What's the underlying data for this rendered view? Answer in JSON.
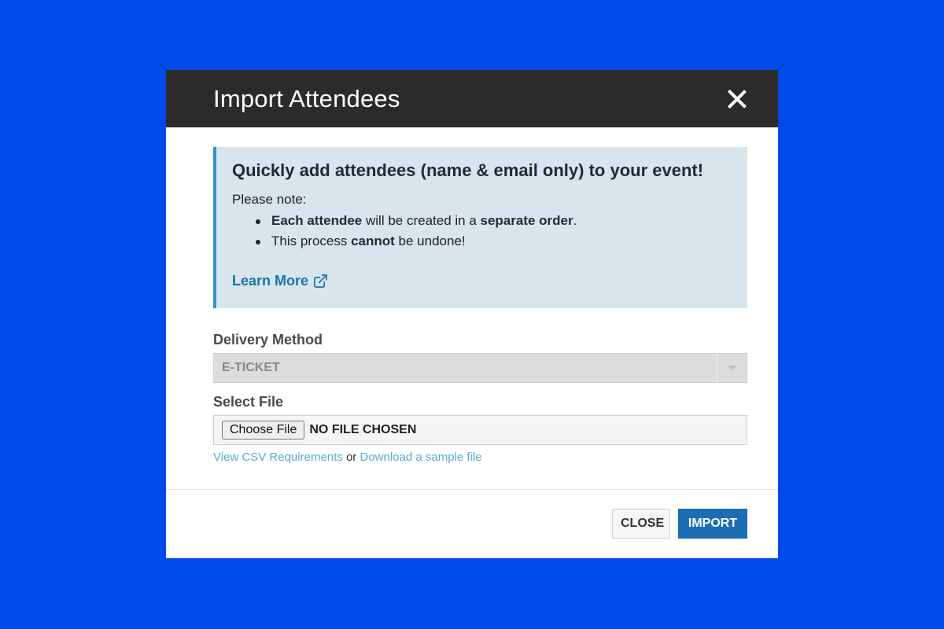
{
  "dialog": {
    "title": "Import Attendees",
    "close_icon": "close-icon"
  },
  "notice": {
    "heading": "Quickly add attendees (name & email only) to your event!",
    "note": "Please note:",
    "bullets": [
      {
        "pre": "",
        "bold1": "Each attendee",
        "mid": " will be created in a ",
        "bold2": "separate order",
        "post": "."
      },
      {
        "pre": "This process ",
        "bold1": "cannot",
        "mid": " be undone!",
        "bold2": "",
        "post": ""
      }
    ],
    "learn_more": "Learn More",
    "learn_more_icon": "external-link-icon"
  },
  "form": {
    "delivery_label": "Delivery Method",
    "delivery_value": "E-TICKET",
    "file_label": "Select File",
    "choose_file_label": "Choose File",
    "file_status": "NO FILE CHOSEN",
    "csv_link": "View CSV Requirements",
    "or_text": "or",
    "sample_link": "Download a sample file"
  },
  "footer": {
    "close_label": "CLOSE",
    "import_label": "IMPORT"
  },
  "colors": {
    "background": "#0249ea",
    "header": "#2b2b2b",
    "notice_bg": "#d8e5ec",
    "notice_accent": "#2d95d6",
    "primary": "#1d6db4",
    "link": "#5aa9d8"
  }
}
